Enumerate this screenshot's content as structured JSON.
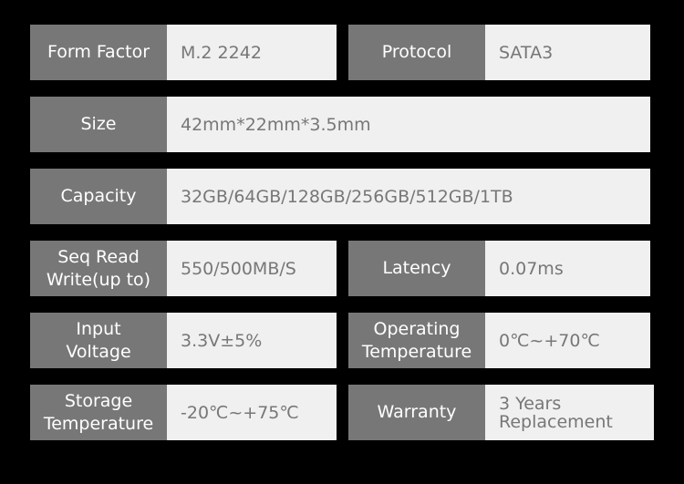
{
  "specs": [
    {
      "label": "Form Factor",
      "value": "M.2 2242"
    },
    {
      "label": "Protocol",
      "value": "SATA3"
    },
    {
      "label": "Size",
      "value": "42mm*22mm*3.5mm"
    },
    {
      "label": "Capacity",
      "value": "32GB/64GB/128GB/256GB/512GB/1TB"
    },
    {
      "label": "Seq Read\nWrite(up to)",
      "value": "550/500MB/S"
    },
    {
      "label": "Latency",
      "value": "0.07ms"
    },
    {
      "label": "Input\nVoltage",
      "value": "3.3V±5%"
    },
    {
      "label": "Operating\nTemperature",
      "value": "0℃~+70℃"
    },
    {
      "label": "Storage\nTemperature",
      "value": "-20℃~+75℃"
    },
    {
      "label": "Warranty",
      "value": "3 Years\nReplacement"
    }
  ],
  "colors": {
    "label_bg": "#777777",
    "value_bg": "#f0f0f0",
    "value_text": "#777777",
    "background": "#000000"
  }
}
